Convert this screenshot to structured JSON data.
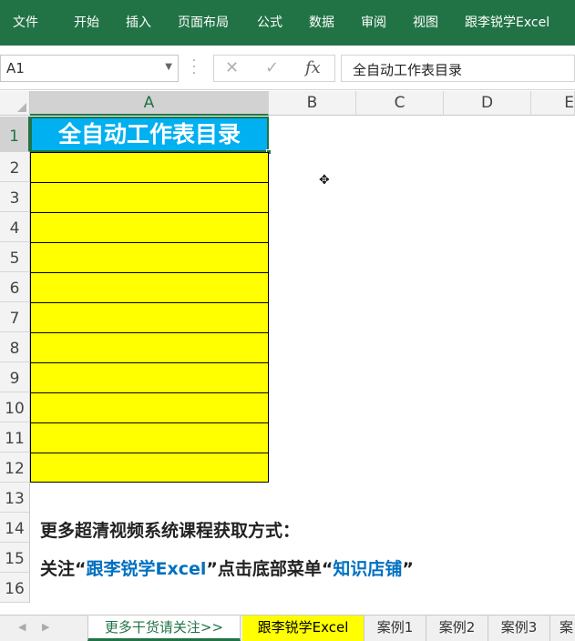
{
  "ribbon": {
    "tabs": [
      "文件",
      "开始",
      "插入",
      "页面布局",
      "公式",
      "数据",
      "审阅",
      "视图",
      "跟李锐学Excel"
    ]
  },
  "formula_bar": {
    "name_box": "A1",
    "cancel_symbol": "✕",
    "enter_symbol": "✓",
    "fx_symbol": "fx",
    "content": "全自动工作表目录"
  },
  "columns": [
    "A",
    "B",
    "C",
    "D",
    "E"
  ],
  "rows": [
    "1",
    "2",
    "3",
    "4",
    "5",
    "6",
    "7",
    "8",
    "9",
    "10",
    "11",
    "12",
    "13",
    "14",
    "15",
    "16"
  ],
  "cells": {
    "A1": "全自动工作表目录"
  },
  "promo": {
    "line1": "更多超清视频系统课程获取方式：",
    "line2_part1": "关注“",
    "line2_link1": "跟李锐学Excel",
    "line2_part2": "”点击底部菜单“",
    "line2_link2": "知识店铺",
    "line2_part3": "”"
  },
  "sheet_tabs": [
    "更多干货请关注>>",
    "跟李锐学Excel",
    "案例1",
    "案例2",
    "案例3",
    "案"
  ],
  "colors": {
    "ribbon": "#217346",
    "header_fill": "#00b0f0",
    "highlight": "#ffff00",
    "link_blue": "#0070c0"
  }
}
